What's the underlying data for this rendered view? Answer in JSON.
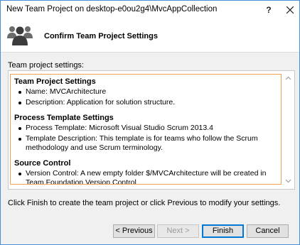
{
  "window": {
    "title": "New Team Project on desktop-e0ou2g4\\MvcAppCollection",
    "help_glyph": "?",
    "accent_color": "#0078d7"
  },
  "banner": {
    "title": "Confirm Team Project Settings",
    "icon": "team-people-icon"
  },
  "settings": {
    "label": "Team project settings:",
    "sections": [
      {
        "heading": "Team Project Settings",
        "items": [
          "Name: MVCArchitecture",
          "Description: Application for solution structure."
        ]
      },
      {
        "heading": "Process Template Settings",
        "items": [
          "Process Template: Microsoft Visual Studio Scrum 2013.4",
          "Template Description: This template is for teams who follow the Scrum methodology and use Scrum terminology."
        ]
      },
      {
        "heading": "Source Control",
        "items": [
          "Version Control: A new empty folder $/MVCArchitecture will be created in Team Foundation Version Control"
        ]
      }
    ]
  },
  "footer": {
    "instruction": "Click Finish to create the team project or click Previous to modify your settings."
  },
  "buttons": {
    "previous": "< Previous",
    "next": "Next >",
    "finish": "Finish",
    "cancel": "Cancel"
  }
}
